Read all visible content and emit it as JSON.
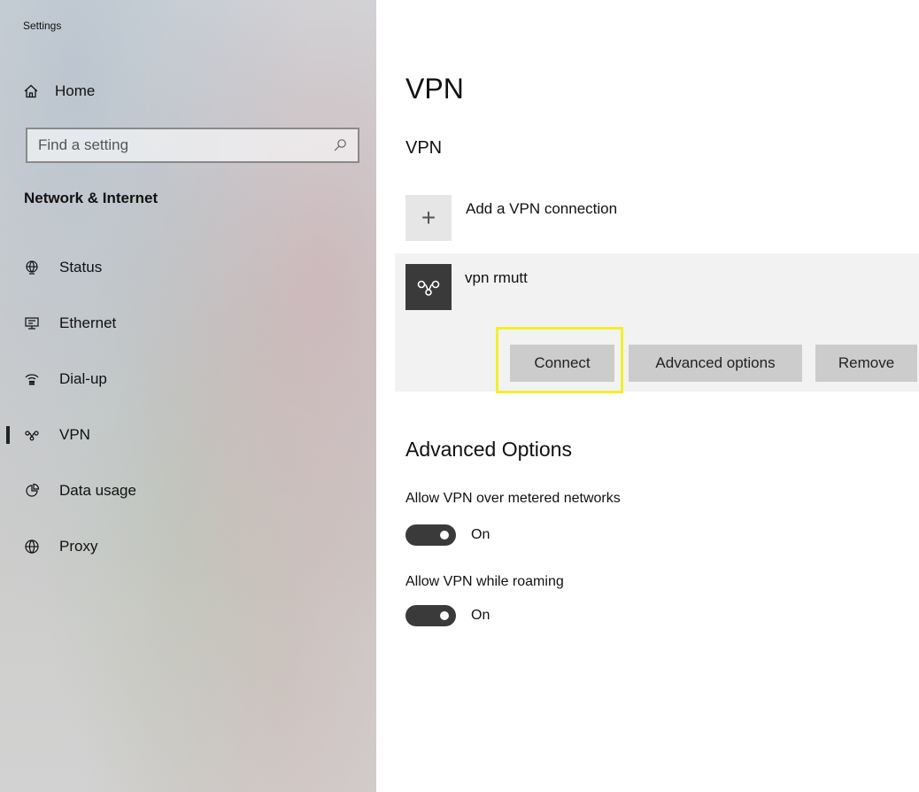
{
  "window": {
    "title": "Settings"
  },
  "sidebar": {
    "home_label": "Home",
    "search_placeholder": "Find a setting",
    "section_title": "Network & Internet",
    "items": [
      {
        "label": "Status",
        "icon": "globe-status-icon",
        "selected": false
      },
      {
        "label": "Ethernet",
        "icon": "ethernet-icon",
        "selected": false
      },
      {
        "label": "Dial-up",
        "icon": "dial-up-icon",
        "selected": false
      },
      {
        "label": "VPN",
        "icon": "vpn-icon",
        "selected": true
      },
      {
        "label": "Data usage",
        "icon": "data-usage-icon",
        "selected": false
      },
      {
        "label": "Proxy",
        "icon": "globe-icon",
        "selected": false
      }
    ]
  },
  "main": {
    "page_title": "VPN",
    "section_title": "VPN",
    "add_connection_label": "Add a VPN connection",
    "connection": {
      "name": "vpn rmutt",
      "connect_label": "Connect",
      "advanced_label": "Advanced options",
      "remove_label": "Remove"
    },
    "advanced": {
      "title": "Advanced Options",
      "metered_label": "Allow VPN over metered networks",
      "metered_state": "On",
      "roaming_label": "Allow VPN while roaming",
      "roaming_state": "On"
    }
  },
  "colors": {
    "highlight": "#f2ef2c",
    "toggle_on": "#3a3a3a",
    "button_bg": "#cccccc",
    "card_bg": "#f2f2f2"
  }
}
